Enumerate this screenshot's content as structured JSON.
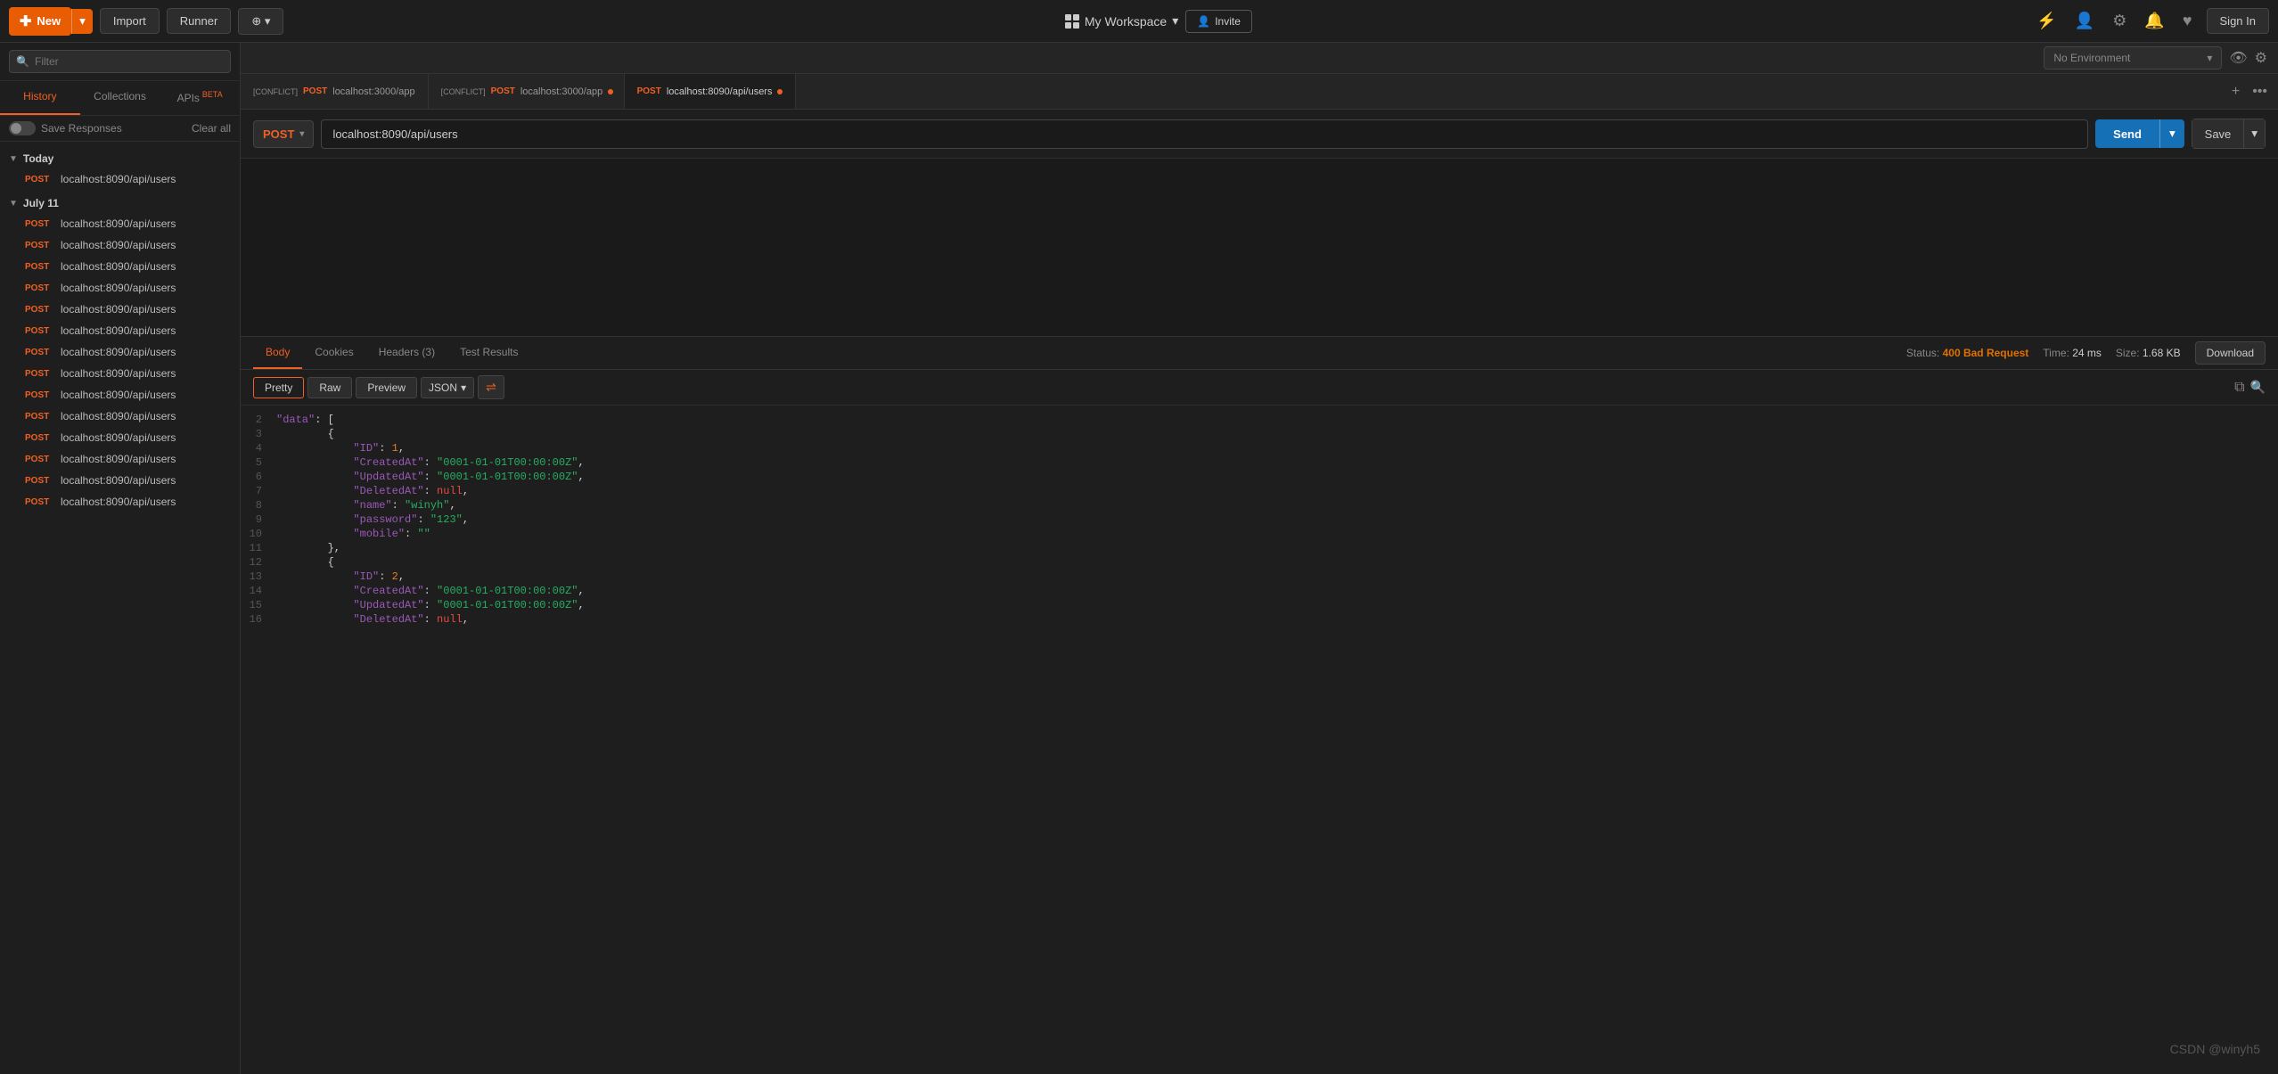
{
  "topbar": {
    "new_label": "New",
    "import_label": "Import",
    "runner_label": "Runner",
    "workspace_label": "My Workspace",
    "invite_label": "Invite",
    "sign_in_label": "Sign In"
  },
  "sidebar": {
    "filter_placeholder": "Filter",
    "history_label": "History",
    "collections_label": "Collections",
    "apis_label": "APIs",
    "apis_beta": "BETA",
    "save_responses_label": "Save Responses",
    "clear_all_label": "Clear all",
    "today_label": "Today",
    "today_items": [
      {
        "method": "POST",
        "url": "localhost:8090/api/users"
      }
    ],
    "july11_label": "July 11",
    "july11_items": [
      {
        "method": "POST",
        "url": "localhost:8090/api/users"
      },
      {
        "method": "POST",
        "url": "localhost:8090/api/users"
      },
      {
        "method": "POST",
        "url": "localhost:8090/api/users"
      },
      {
        "method": "POST",
        "url": "localhost:8090/api/users"
      },
      {
        "method": "POST",
        "url": "localhost:8090/api/users"
      },
      {
        "method": "POST",
        "url": "localhost:8090/api/users"
      },
      {
        "method": "POST",
        "url": "localhost:8090/api/users"
      },
      {
        "method": "POST",
        "url": "localhost:8090/api/users"
      },
      {
        "method": "POST",
        "url": "localhost:8090/api/users"
      },
      {
        "method": "POST",
        "url": "localhost:8090/api/users"
      },
      {
        "method": "POST",
        "url": "localhost:8090/api/users"
      },
      {
        "method": "POST",
        "url": "localhost:8090/api/users"
      },
      {
        "method": "POST",
        "url": "localhost:8090/api/users"
      },
      {
        "method": "POST",
        "url": "localhost:8090/api/users"
      }
    ]
  },
  "tabs": [
    {
      "id": 1,
      "conflict": "[CONFLICT]",
      "method": "POST",
      "url": "localhost:3000/app",
      "active": false,
      "dot": false
    },
    {
      "id": 2,
      "conflict": "[CONFLICT]",
      "method": "POST",
      "url": "localhost:3000/app",
      "active": false,
      "dot": true
    },
    {
      "id": 3,
      "conflict": "",
      "method": "POST",
      "url": "localhost:8090/api/users",
      "active": true,
      "dot": true
    }
  ],
  "request": {
    "method": "POST",
    "url": "localhost:8090/api/users",
    "send_label": "Send",
    "save_label": "Save"
  },
  "environment": {
    "label": "No Environment"
  },
  "response": {
    "body_label": "Body",
    "cookies_label": "Cookies",
    "headers_label": "Headers",
    "headers_count": "3",
    "test_results_label": "Test Results",
    "status_label": "Status:",
    "status_value": "400 Bad Request",
    "time_label": "Time:",
    "time_value": "24 ms",
    "size_label": "Size:",
    "size_value": "1.68 KB",
    "download_label": "Download",
    "pretty_label": "Pretty",
    "raw_label": "Raw",
    "preview_label": "Preview",
    "format_label": "JSON",
    "lines": [
      {
        "num": "2",
        "content": "    \"data\": [",
        "type": "mixed"
      },
      {
        "num": "3",
        "content": "        {",
        "type": "bracket"
      },
      {
        "num": "4",
        "content": "            \"ID\": 1,",
        "type": "mixed"
      },
      {
        "num": "5",
        "content": "            \"CreatedAt\": \"0001-01-01T00:00:00Z\",",
        "type": "mixed"
      },
      {
        "num": "6",
        "content": "            \"UpdatedAt\": \"0001-01-01T00:00:00Z\",",
        "type": "mixed"
      },
      {
        "num": "7",
        "content": "            \"DeletedAt\": null,",
        "type": "mixed"
      },
      {
        "num": "8",
        "content": "            \"name\": \"winyh\",",
        "type": "mixed"
      },
      {
        "num": "9",
        "content": "            \"password\": \"123\",",
        "type": "mixed"
      },
      {
        "num": "10",
        "content": "            \"mobile\": \"\"",
        "type": "mixed"
      },
      {
        "num": "11",
        "content": "        },",
        "type": "bracket"
      },
      {
        "num": "12",
        "content": "        {",
        "type": "bracket"
      },
      {
        "num": "13",
        "content": "            \"ID\": 2,",
        "type": "mixed"
      },
      {
        "num": "14",
        "content": "            \"CreatedAt\": \"0001-01-01T00:00:00Z\",",
        "type": "mixed"
      },
      {
        "num": "15",
        "content": "            \"UpdatedAt\": \"0001-01-01T00:00:00Z\",",
        "type": "mixed"
      },
      {
        "num": "16",
        "content": "            \"DeletedAt\": null,",
        "type": "mixed"
      }
    ]
  },
  "watermark": "CSDN @winyh5"
}
